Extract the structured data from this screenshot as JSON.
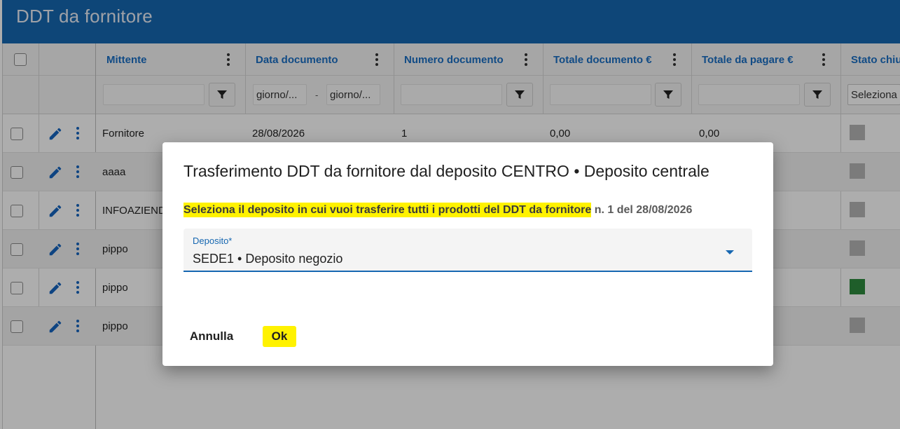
{
  "app": {
    "title": "DDT da fornitore"
  },
  "grid": {
    "columns": [
      {
        "label": "Mittente"
      },
      {
        "label": "Data documento"
      },
      {
        "label": "Numero documento"
      },
      {
        "label": "Totale documento €"
      },
      {
        "label": "Totale da pagare €"
      },
      {
        "label": "Stato chiu"
      }
    ],
    "filters": {
      "date_from_placeholder": "giorno/...",
      "date_to_placeholder": "giorno/...",
      "date_separator": "-",
      "status_select": "Seleziona"
    },
    "rows": [
      {
        "mittente": "Fornitore",
        "data": "28/08/2026",
        "numero": "1",
        "totale": "0,00",
        "da_pagare": "0,00",
        "status_color": "#b5b5b5"
      },
      {
        "mittente": "aaaa",
        "data": "",
        "numero": "",
        "totale": "",
        "da_pagare": "",
        "status_color": "#b5b5b5"
      },
      {
        "mittente": "INFOAZIEND",
        "data": "",
        "numero": "",
        "totale": "",
        "da_pagare": "",
        "status_color": "#b5b5b5"
      },
      {
        "mittente": "pippo",
        "data": "",
        "numero": "",
        "totale": "",
        "da_pagare": "",
        "status_color": "#b5b5b5"
      },
      {
        "mittente": "pippo",
        "data": "",
        "numero": "",
        "totale": "",
        "da_pagare": "",
        "status_color": "#2e8b3e"
      },
      {
        "mittente": "pippo",
        "data": "",
        "numero": "",
        "totale": "",
        "da_pagare": "",
        "status_color": "#b5b5b5"
      }
    ]
  },
  "dialog": {
    "title": "Trasferimento DDT da fornitore dal deposito CENTRO • Deposito centrale",
    "message_highlighted": "Seleziona il deposito in cui vuoi trasferire tutti i prodotti del DDT da fornitore",
    "message_rest": " n. 1 del 28/08/2026",
    "select_label": "Deposito*",
    "select_value": "SEDE1 • Deposito negozio",
    "cancel_label": "Annulla",
    "ok_label": "Ok"
  },
  "colors": {
    "primary": "#1667b1",
    "highlight": "#fff200"
  }
}
